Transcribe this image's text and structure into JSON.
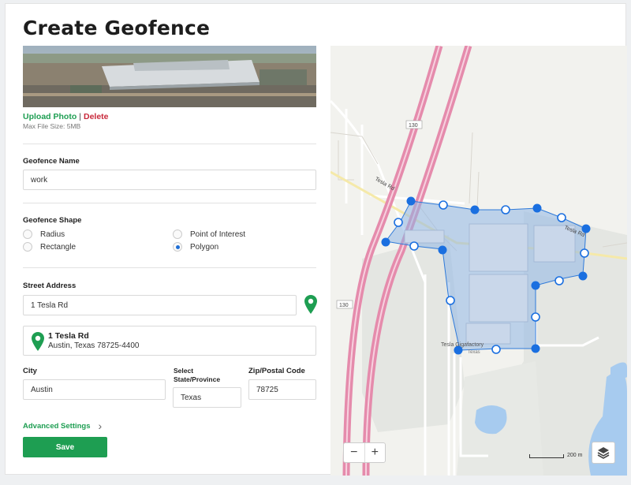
{
  "page": {
    "title": "Create Geofence"
  },
  "photo": {
    "upload_label": "Upload Photo",
    "separator": "|",
    "delete_label": "Delete",
    "max_size": "Max File Size: 5MB"
  },
  "name": {
    "label": "Geofence Name",
    "value": "work"
  },
  "shape": {
    "label": "Geofence Shape",
    "options": [
      {
        "label": "Radius",
        "selected": false
      },
      {
        "label": "Rectangle",
        "selected": false
      },
      {
        "label": "Point of Interest",
        "selected": false
      },
      {
        "label": "Polygon",
        "selected": true
      }
    ]
  },
  "address": {
    "label": "Street Address",
    "value": "1 Tesla Rd",
    "result_line1": "1 Tesla Rd",
    "result_line2": "Austin, Texas 78725-4400"
  },
  "city": {
    "label": "City",
    "value": "Austin"
  },
  "state": {
    "label": "Select State/Province",
    "value": "Texas"
  },
  "zip": {
    "label": "Zip/Postal Code",
    "value": "78725"
  },
  "advanced": {
    "label": "Advanced Settings"
  },
  "save": {
    "label": "Save"
  },
  "map": {
    "road_label_1": "130",
    "road_label_2": "130",
    "road_label_tesla_1": "Tesla Rd",
    "road_label_tesla_2": "Tesla Rd",
    "place_label": "Tesla Gigafactory",
    "place_sub": "Texas",
    "scale_label": "200 m",
    "zoom_out": "−",
    "zoom_in": "+",
    "colors": {
      "fence_fill": "#8fb6e6",
      "fence_stroke": "#2f7ad9",
      "vertex": "#1a6fe0",
      "highway": "#e58bac",
      "primary": "#1e9e52",
      "delete": "#c8283a"
    }
  }
}
